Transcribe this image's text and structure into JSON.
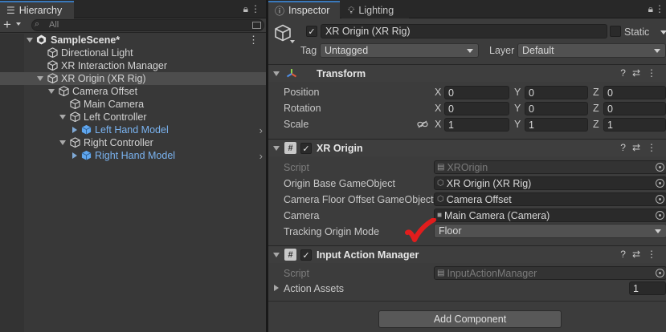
{
  "hierarchy": {
    "tab_label": "Hierarchy",
    "search_placeholder": "All",
    "scene": "SampleScene*",
    "items": [
      {
        "label": "Directional Light"
      },
      {
        "label": "XR Interaction Manager"
      },
      {
        "label": "XR Origin (XR Rig)"
      },
      {
        "label": "Camera Offset"
      },
      {
        "label": "Main Camera"
      },
      {
        "label": "Left Controller"
      },
      {
        "label": "Left Hand Model"
      },
      {
        "label": "Right Controller"
      },
      {
        "label": "Right Hand Model"
      }
    ]
  },
  "inspector": {
    "tab_label": "Inspector",
    "lighting_tab_label": "Lighting",
    "object_name": "XR Origin (XR Rig)",
    "static_label": "Static",
    "tag_label": "Tag",
    "tag_value": "Untagged",
    "layer_label": "Layer",
    "layer_value": "Default",
    "add_component_label": "Add Component",
    "transform": {
      "title": "Transform",
      "rows": [
        {
          "label": "Position",
          "x": "0",
          "y": "0",
          "z": "0"
        },
        {
          "label": "Rotation",
          "x": "0",
          "y": "0",
          "z": "0"
        },
        {
          "label": "Scale",
          "x": "1",
          "y": "1",
          "z": "1"
        }
      ],
      "axis_x": "X",
      "axis_y": "Y",
      "axis_z": "Z"
    },
    "xr_origin": {
      "title": "XR Origin",
      "fields": [
        {
          "label": "Script",
          "value": "XROrigin"
        },
        {
          "label": "Origin Base GameObject",
          "value": "XR Origin (XR Rig)"
        },
        {
          "label": "Camera Floor Offset GameObject",
          "value": "Camera Offset"
        },
        {
          "label": "Camera",
          "value": "Main Camera (Camera)"
        },
        {
          "label": "Tracking Origin Mode",
          "value": "Floor"
        }
      ]
    },
    "input_action_manager": {
      "title": "Input Action Manager",
      "script_label": "Script",
      "script_value": "InputActionManager",
      "assets_label": "Action Assets",
      "assets_count": "1"
    }
  },
  "colors": {
    "accent": "#3a79bb",
    "prefab_blue": "#7ab3f0",
    "annotation_red": "#e11d1d"
  }
}
